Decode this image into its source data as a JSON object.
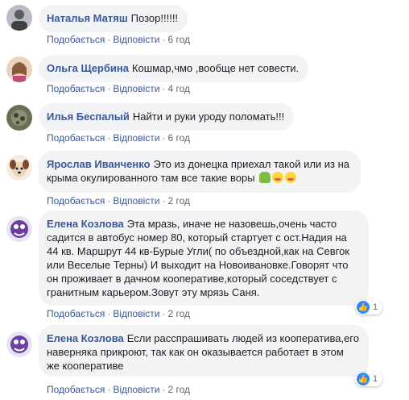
{
  "labels": {
    "like": "Подобається",
    "reply": "Відповісти",
    "sep": "·"
  },
  "comments": [
    {
      "author": "Наталья Матяш",
      "text": "Позор!!!!!!",
      "time": "6 год"
    },
    {
      "author": "Ольга Щербина",
      "text": "Кошмар,чмо ,вообще нет совести.",
      "time": "4 год"
    },
    {
      "author": "Илья Беспалый",
      "text": "Найти и руки уроду поломать!!!",
      "time": "6 год"
    },
    {
      "author": "Ярослав Иванченко",
      "text": "Это из донецка приехал такой или из на крыма окулированного там все такие воры",
      "time": "2 год"
    },
    {
      "author": "Елена Козлова",
      "text": "Эта мразь, иначе не назовешь,очень часто садится в автобус номер 80, который стартует с ост.Надия на 44 кв. Маршрут 44 кв-Бурые Угли( по объездной,как на Севгок или Веселые Терны) И выходит на Новоивановке.Говорят что он проживает в дачном кооперативе,который соседствует с гранитным карьером.Зовут эту мрязь Саня.",
      "time": "2 год",
      "likes": "1"
    },
    {
      "author": "Елена Козлова",
      "text": "Если расспрашивать людей из кооператива,его наверняка прикроют, так как он оказывается работает в этом же кооперативе",
      "time": "2 год",
      "likes": "1"
    }
  ],
  "icons": {
    "like": "thumbs-up-icon",
    "emoji_person": "person-emoji-icon",
    "emoji_face": "tongue-face-emoji-icon"
  },
  "colors": {
    "author": "#385898",
    "bubble": "#f2f3f5",
    "like_badge": "#2d88ff"
  }
}
